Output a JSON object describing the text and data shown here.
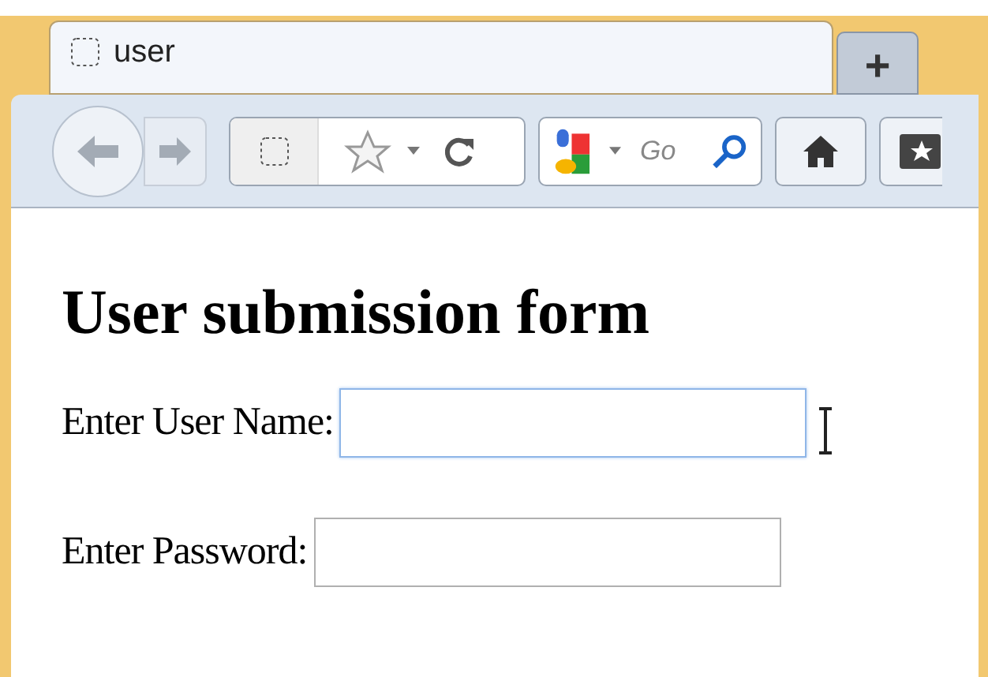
{
  "tabs": [
    {
      "label": "user",
      "selected": true
    },
    {
      "label": "+",
      "selected": false
    }
  ],
  "search": {
    "placeholder": "Go"
  },
  "page": {
    "heading": "User submission form",
    "fields": [
      {
        "label": "Enter User Name:",
        "focused": true
      },
      {
        "label": "Enter Password:",
        "focused": false
      }
    ]
  }
}
